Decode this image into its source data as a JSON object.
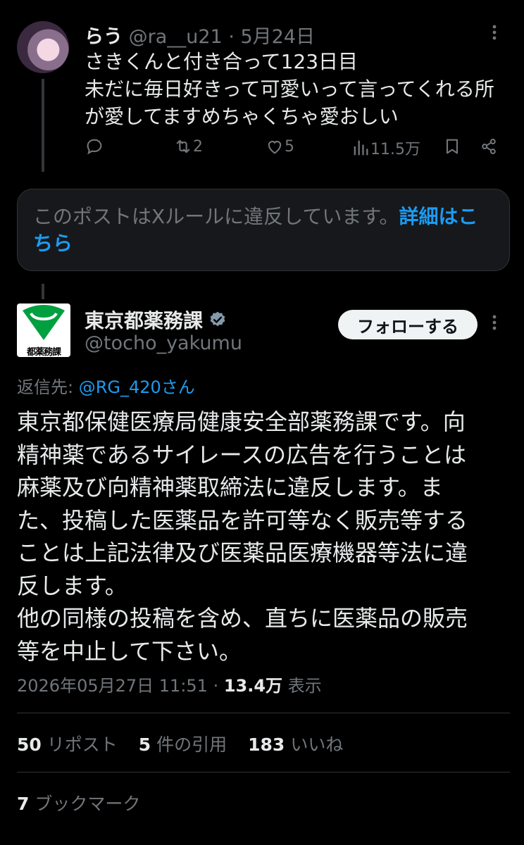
{
  "reply_tweet": {
    "display_name": "らう",
    "handle": "@ra__u21",
    "separator": "·",
    "date": "5月24日",
    "body_lines": [
      "さきくんと付き合って123日目",
      "未だに毎日好きって可愛いって言ってくれる所",
      "が愛してますめちゃくちゃ愛おしい"
    ],
    "actions": {
      "reply": "",
      "reposts": "2",
      "likes": "5",
      "views": "11.5万"
    },
    "icons": [
      "reply-icon",
      "repost-icon",
      "like-icon",
      "views-icon",
      "bookmark-icon",
      "share-icon",
      "more-icon"
    ]
  },
  "notice": {
    "text": "このポストはXルールに違反しています。",
    "link": "詳細はこちら"
  },
  "main_tweet": {
    "display_name": "東京都薬務課",
    "handle": "@tocho_yakumu",
    "logo_text": "都薬務課",
    "follow_label": "フォローする",
    "replying_label": "返信先: ",
    "replying_to": "@RG_420さん",
    "body": "東京都保健医療局健康安全部薬務課です。向\n精神薬であるサイレースの広告を行うことは\n麻薬及び向精神薬取締法に違反します。ま\nた、投稿した医薬品を許可等なく販売等する\nことは上記法律及び医薬品医療機器等法に違\n反します。\n他の同様の投稿を含め、直ちに医薬品の販売\n等を中止して下さい。",
    "timestamp": "2026年05月27日 11:51",
    "separator": " · ",
    "views_count": "13.4万",
    "views_label": " 表示",
    "stats": {
      "reposts_count": "50",
      "reposts_label": "リポスト",
      "quotes_count": "5",
      "quotes_label": "件の引用",
      "likes_count": "183",
      "likes_label": "いいね",
      "bookmarks_count": "7",
      "bookmarks_label": "ブックマーク"
    }
  },
  "colors": {
    "background": "#000000",
    "text": "#e7e9ea",
    "muted": "#71767b",
    "accent": "#1d9bf0",
    "logo_green": "#00a040",
    "verified": "#829aab"
  }
}
